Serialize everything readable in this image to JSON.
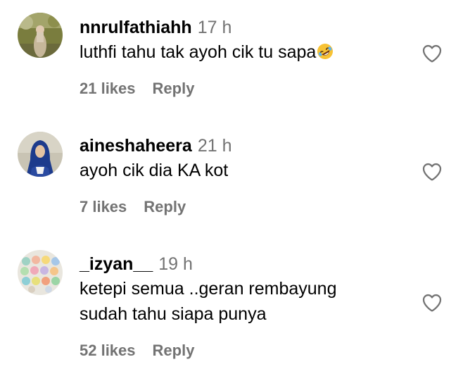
{
  "comments": [
    {
      "username": "nnrulfathiahh",
      "time": "17 h",
      "text": "luthfi tahu tak ayoh cik tu sapa",
      "emoji": "rolling-on-floor-laughing-emoji",
      "likes": "21 likes",
      "reply": "Reply"
    },
    {
      "username": "aineshaheera",
      "time": "21 h",
      "text": "ayoh cik dia KA kot",
      "likes": "7 likes",
      "reply": "Reply"
    },
    {
      "username": "_izyan__",
      "time": "19 h",
      "text_line1": "ketepi semua ..geran rembayung",
      "text_line2": "sudah tahu siapa punya",
      "likes": "52 likes",
      "reply": "Reply"
    }
  ],
  "icons": {
    "like": "heart-outline-icon"
  },
  "colors": {
    "text": "#000000",
    "secondary": "#737373",
    "background": "#ffffff"
  }
}
